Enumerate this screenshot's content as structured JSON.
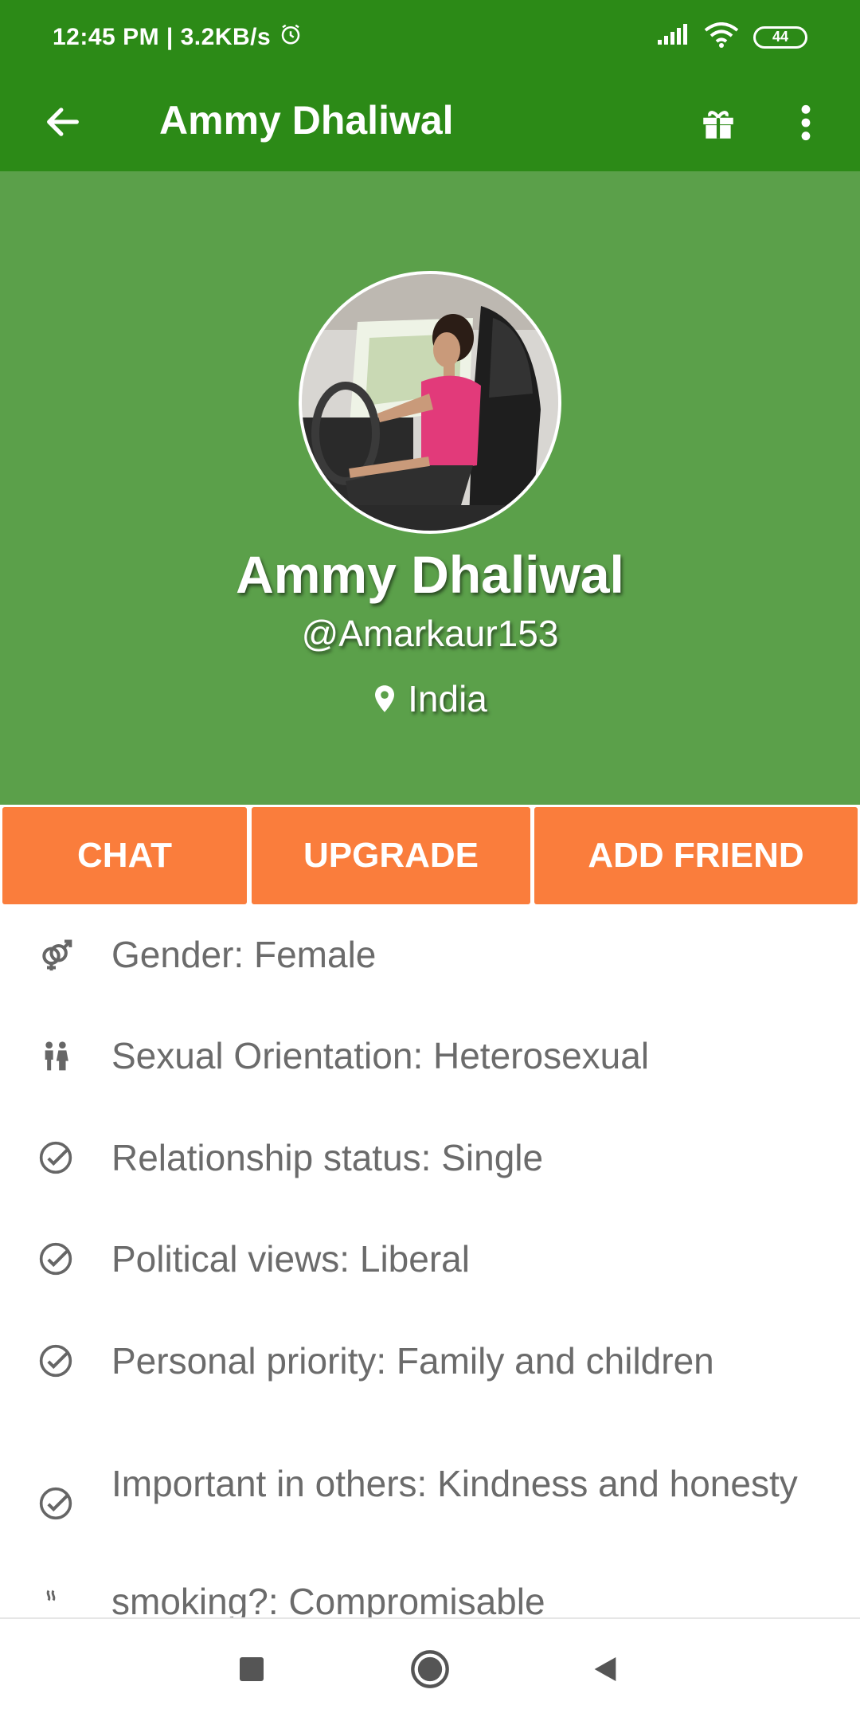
{
  "status_bar": {
    "time_speed": "12:45 PM | 3.2KB/s",
    "battery": "44"
  },
  "app_bar": {
    "title": "Ammy Dhaliwal"
  },
  "profile": {
    "name": "Ammy Dhaliwal",
    "username": "@Amarkaur153",
    "location": "India"
  },
  "actions": {
    "chat": "CHAT",
    "upgrade": "UPGRADE",
    "add_friend": "ADD FRIEND"
  },
  "details": [
    {
      "icon": "gender-icon",
      "text": "Gender: Female"
    },
    {
      "icon": "couple-icon",
      "text": "Sexual Orientation: Heterosexual"
    },
    {
      "icon": "check-circle-icon",
      "text": "Relationship status: Single"
    },
    {
      "icon": "check-circle-icon",
      "text": "Political views: Liberal"
    },
    {
      "icon": "check-circle-icon",
      "text": "Personal priority: Family and children"
    },
    {
      "icon": "check-circle-icon",
      "text": "Important in others: Kindness and honesty"
    },
    {
      "icon": "smoking-icon",
      "text": "smoking?: Compromisable"
    }
  ],
  "colors": {
    "app_bar": "#2c8a17",
    "hero": "#5ba04a",
    "action": "#fa7d3c",
    "detail_text": "#6b6b6b"
  }
}
